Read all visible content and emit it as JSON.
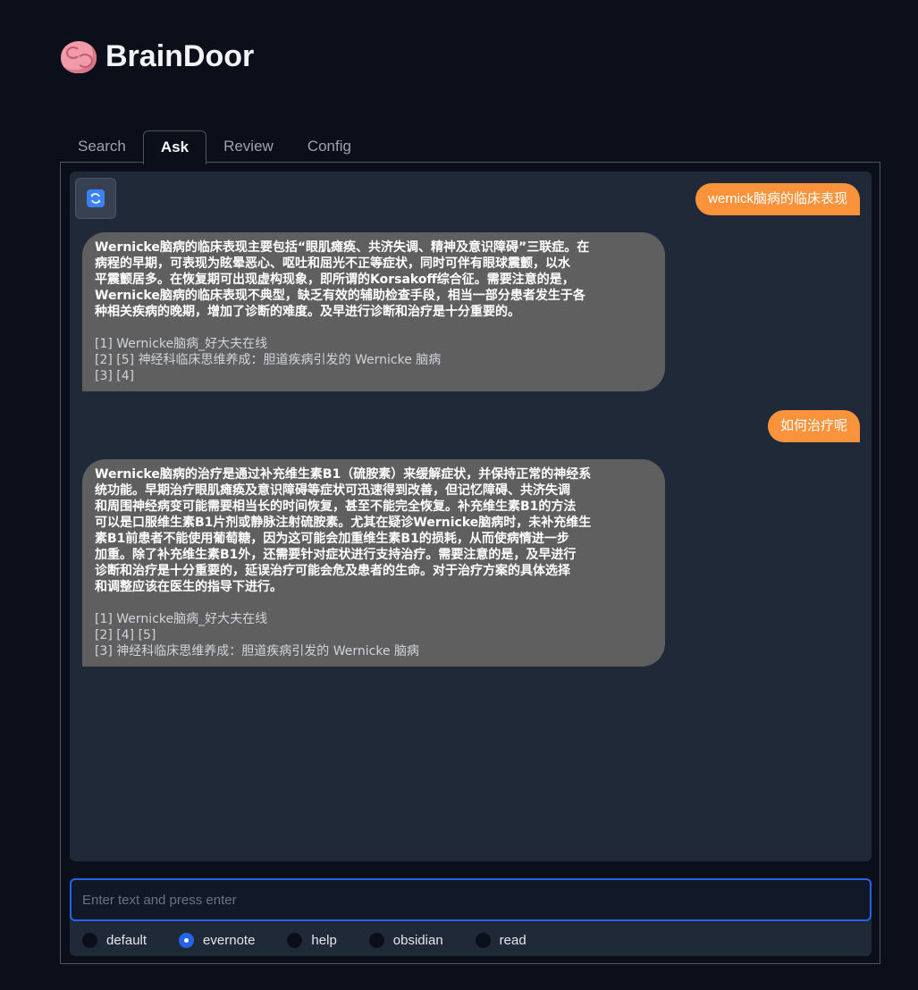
{
  "app": {
    "title": "BrainDoor",
    "icon": "brain-icon"
  },
  "tabs": [
    {
      "label": "Search",
      "active": false
    },
    {
      "label": "Ask",
      "active": true
    },
    {
      "label": "Review",
      "active": false
    },
    {
      "label": "Config",
      "active": false
    }
  ],
  "chat": {
    "refresh_icon": "refresh-icon",
    "messages": [
      {
        "role": "user",
        "text": "wernick脑病的临床表现"
      },
      {
        "role": "bot",
        "lines": [
          "Wernicke脑病的临床表现主要包括“眼肌瘫痪、共济失调、精神及意识障碍”三联症。在",
          "病程的早期，可表现为眩晕恶心、呕吐和屈光不正等症状，同时可伴有眼球震颤，以水",
          "平震颤居多。在恢复期可出现虚构现象，即所谓的Korsakoff综合征。需要注意的是，",
          "Wernicke脑病的临床表现不典型，缺乏有效的辅助检查手段，相当一部分患者发生于各",
          "种相关疾病的晚期，增加了诊断的难度。及早进行诊断和治疗是十分重要的。"
        ],
        "refs": [
          "[1] Wernicke脑病_好大夫在线",
          "[2] [5] 神经科临床思维养成：胆道疾病引发的 Wernicke 脑病",
          "[3] [4]"
        ]
      },
      {
        "role": "user",
        "text": "如何治疗呢"
      },
      {
        "role": "bot",
        "lines": [
          "Wernicke脑病的治疗是通过补充维生素B1（硫胺素）来缓解症状，并保持正常的神经系",
          "统功能。早期治疗眼肌瘫痪及意识障碍等症状可迅速得到改善，但记忆障碍、共济失调",
          "和周围神经病变可能需要相当长的时间恢复，甚至不能完全恢复。补充维生素B1的方法",
          "可以是口服维生素B1片剂或静脉注射硫胺素。尤其在疑诊Wernicke脑病时，未补充维生",
          "素B1前患者不能使用葡萄糖，因为这可能会加重维生素B1的损耗，从而使病情进一步",
          "加重。除了补充维生素B1外，还需要针对症状进行支持治疗。需要注意的是，及早进行",
          "诊断和治疗是十分重要的，延误治疗可能会危及患者的生命。对于治疗方案的具体选择",
          "和调整应该在医生的指导下进行。"
        ],
        "refs": [
          "[1] Wernicke脑病_好大夫在线",
          "[2] [4] [5]",
          "[3] 神经科临床思维养成：胆道疾病引发的 Wernicke 脑病"
        ]
      }
    ]
  },
  "input": {
    "placeholder": "Enter text and press enter",
    "value": ""
  },
  "modes": {
    "selected": "evernote",
    "options": [
      "default",
      "evernote",
      "help",
      "obsidian",
      "read"
    ]
  },
  "colors": {
    "background": "#0b0f19",
    "chat_bg": "#1f2937",
    "user_bubble": "#fb923c",
    "bot_bubble": "#5f5f5f",
    "accent": "#2563eb"
  }
}
